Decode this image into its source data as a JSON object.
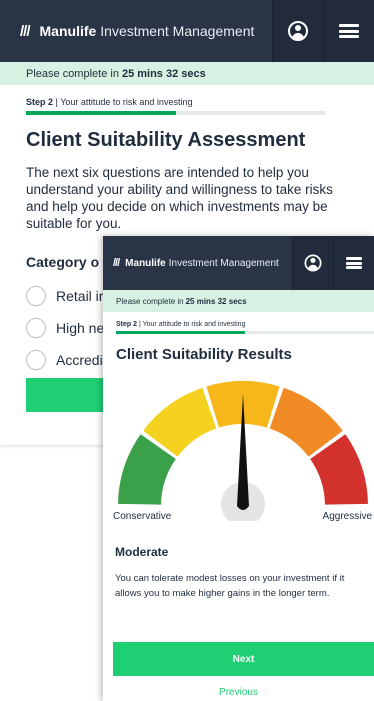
{
  "back_screen": {
    "header": {
      "logo_mark": "///",
      "brand": "Manulife",
      "brand_sub": "Investment Management",
      "user_icon": "user-circle-icon",
      "menu_icon": "hamburger-menu-icon"
    },
    "timer": {
      "prefix": "Please complete in",
      "time": "25 mins 32 secs"
    },
    "step": {
      "label": "Step 2",
      "text": "| Your attitude to risk and investing",
      "progress": 0.5
    },
    "title": "Client Suitability Assessment",
    "intro": "The next six questions are intended to help you understand your ability and willingness to take risks and help you decide on which investments may be suitable for you.",
    "category_label": "Category o",
    "options": [
      "Retail ir",
      "High ne",
      "Accredi"
    ]
  },
  "front_screen": {
    "header": {
      "logo_mark": "///",
      "brand": "Manulife",
      "brand_sub": "Investment Management",
      "user_icon": "user-circle-icon",
      "menu_icon": "hamburger-menu-icon"
    },
    "timer": {
      "prefix": "Please complete in",
      "time": "25 mins 32 secs"
    },
    "step": {
      "label": "Step 2",
      "text": "| Your attitude to risk and investing",
      "progress": 0.5
    },
    "title": "Client Suitability Results",
    "gauge": {
      "segment_colors": [
        "#3aa04a",
        "#f4d21f",
        "#f7b619",
        "#f08a24",
        "#d3322c"
      ],
      "needle_level": 0.5,
      "left_label": "Conservative",
      "right_label": "Aggressive"
    },
    "result_name": "Moderate",
    "result_desc": "You can tolerate modest losses on your investment if it allows you to make higher gains in the longer term.",
    "next_label": "Next",
    "previous_label": "Previous"
  }
}
